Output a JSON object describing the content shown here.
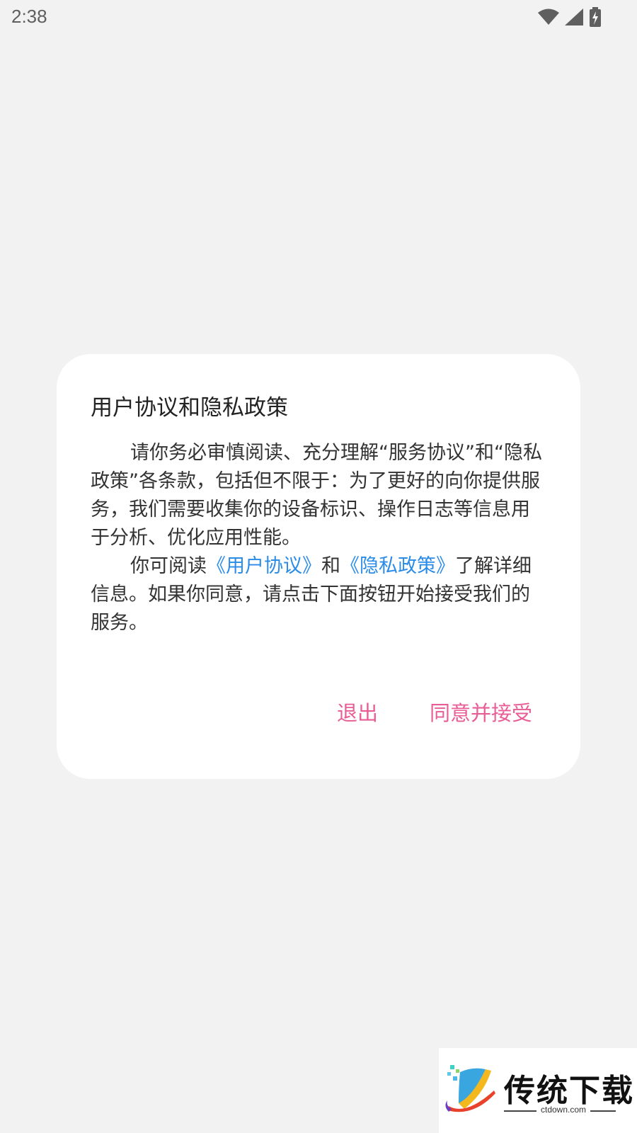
{
  "status_bar": {
    "time": "2:38",
    "icons": [
      "wifi-icon",
      "signal-icon",
      "battery-charging-icon"
    ]
  },
  "dialog": {
    "title": "用户协议和隐私政策",
    "paragraph1": "请你务必审慎阅读、充分理解“服务协议”和“隐私政策”各条款，包括但不限于：为了更好的向你提供服务，我们需要收集你的设备标识、操作日志等信息用于分析、优化应用性能。",
    "paragraph2": {
      "prefix": "你可阅读",
      "link1": "《用户协议》",
      "middle": "和",
      "link2": "《隐私政策》",
      "suffix": "了解详细信息。如果你同意，请点击下面按钮开始接受我们的服务。"
    },
    "buttons": {
      "exit": "退出",
      "accept": "同意并接受"
    }
  },
  "watermark": {
    "title": "传统下载",
    "domain": "ctdown.com"
  },
  "colors": {
    "background": "#f2f2f2",
    "dialog": "#ffffff",
    "link": "#2b8ce8",
    "button": "#e85d95"
  }
}
